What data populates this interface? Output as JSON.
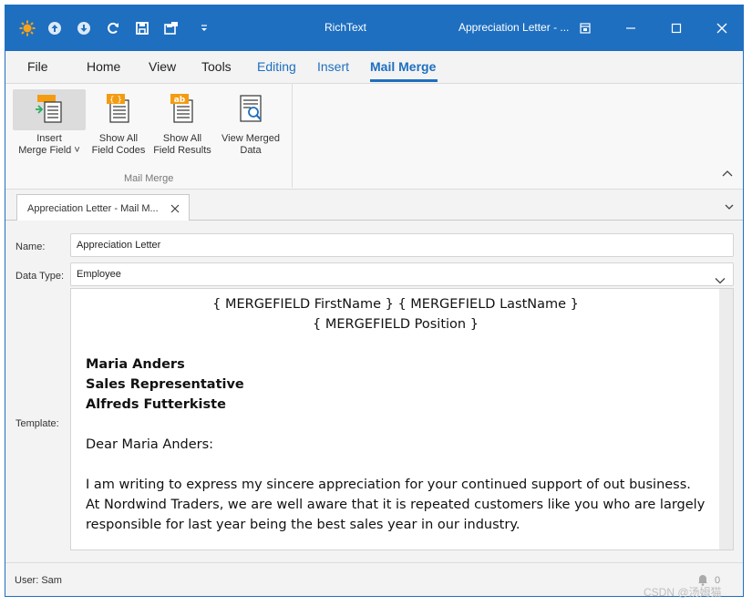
{
  "titlebar": {
    "app_title": "RichText",
    "doc_title": "Appreciation Letter - ...",
    "qat_icons": [
      "app-icon",
      "upload-icon",
      "download-icon",
      "refresh-icon",
      "save-icon",
      "save-layout-icon",
      "customize-icon"
    ],
    "window_buttons": [
      "restore-icon",
      "minimize-icon",
      "maximize-icon",
      "close-icon"
    ],
    "accent": "#1e6fc0"
  },
  "menu": {
    "file": "File",
    "home": "Home",
    "view": "View",
    "tools": "Tools",
    "editing": "Editing",
    "insert": "Insert",
    "mail_merge": "Mail Merge"
  },
  "ribbon": {
    "insert_merge_field": {
      "line1": "Insert",
      "line2": "Merge Field ˅"
    },
    "show_field_codes": {
      "line1": "Show All",
      "line2": "Field Codes"
    },
    "show_field_results": {
      "line1": "Show All",
      "line2": "Field Results"
    },
    "view_merged_data": {
      "line1": "View Merged",
      "line2": "Data"
    },
    "group_label": "Mail Merge"
  },
  "tab": {
    "label": "Appreciation Letter - Mail M..."
  },
  "form": {
    "name_label": "Name:",
    "name_value": "Appreciation Letter",
    "data_type_label": "Data Type:",
    "data_type_value": "Employee",
    "template_label": "Template:"
  },
  "document": {
    "merge_line1": "{ MERGEFIELD FirstName } { MERGEFIELD LastName }",
    "merge_line2": "{ MERGEFIELD Position }",
    "name": "Maria Anders",
    "position": "Sales Representative",
    "company": "Alfreds Futterkiste",
    "greeting": "Dear Maria Anders:",
    "body": "I am writing to express my sincere appreciation for your continued support of out business. At Nordwind Traders, we are well aware that it is repeated customers like you who are largely responsible for last year being the best sales year in our industry."
  },
  "status": {
    "user": "User: Sam",
    "notifications": "0"
  },
  "watermark": "CSDN @汤姆猫"
}
